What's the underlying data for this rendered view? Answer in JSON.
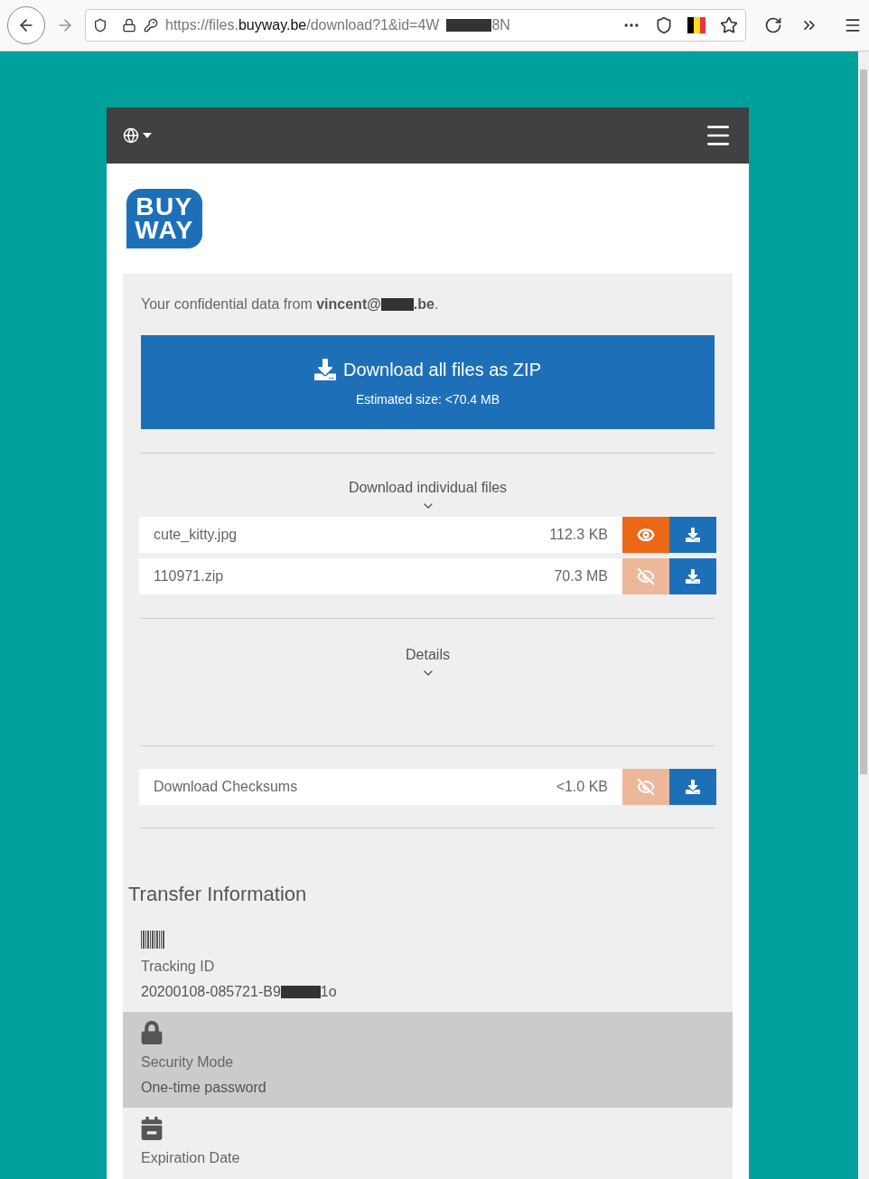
{
  "browser": {
    "url_scheme": "https://files.",
    "url_domain": "buyway.be",
    "url_path": "/download?1&id=4W",
    "url_tail": "8N"
  },
  "logo": {
    "line_1": "BUY",
    "line_2": "WAY"
  },
  "intro": {
    "text": "Your confidential data from ",
    "sender": "vincent@",
    "sender_tail": ".be",
    "end": "."
  },
  "zip_button": {
    "label": "Download all files as ZIP",
    "size": "Estimated size: <70.4 MB"
  },
  "files_section": {
    "title": "Download individual files",
    "expanded": true
  },
  "files": [
    {
      "name": "cute_kitty.jpg",
      "size": "112.3 KB",
      "preview_available": true
    },
    {
      "name": "110971.zip",
      "size": "70.3 MB",
      "preview_available": false
    }
  ],
  "details_section": {
    "title": "Details",
    "expanded": true
  },
  "checksums": {
    "name": "Download Checksums",
    "size": "<1.0 KB",
    "preview_available": false
  },
  "transfer_info": {
    "title": "Transfer Information",
    "items": [
      {
        "kind": "barcode",
        "label": "Tracking ID",
        "value": "20200108-085721-B9",
        "value_tail": "1o",
        "selected": false
      },
      {
        "kind": "lock",
        "label": "Security Mode",
        "value": "One-time password",
        "selected": true
      },
      {
        "kind": "calendar",
        "label": "Expiration Date",
        "selected": false
      }
    ]
  }
}
